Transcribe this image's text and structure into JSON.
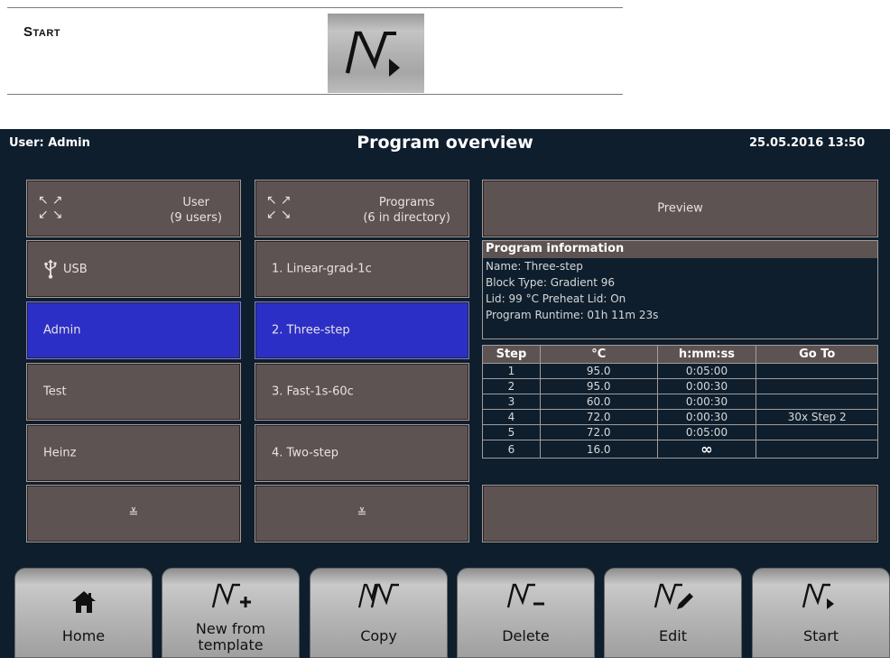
{
  "manual": {
    "label": "Start"
  },
  "status": {
    "user": "User: Admin",
    "title": "Program overview",
    "datetime": "25.05.2016 13:50"
  },
  "user_header": {
    "line1": "User",
    "line2": "(9 users)"
  },
  "programs_header": {
    "line1": "Programs",
    "line2": "(6 in directory)"
  },
  "users": [
    {
      "label": "USB",
      "icon": "usb-icon",
      "selected": false
    },
    {
      "label": "Admin",
      "selected": true
    },
    {
      "label": "Test",
      "selected": false
    },
    {
      "label": "Heinz",
      "selected": false
    }
  ],
  "programs": [
    {
      "label": "1. Linear-grad-1c",
      "selected": false
    },
    {
      "label": "2. Three-step",
      "selected": true
    },
    {
      "label": "3. Fast-1s-60c",
      "selected": false
    },
    {
      "label": "4. Two-step",
      "selected": false
    }
  ],
  "scroll_glyph": "≚",
  "preview_label": "Preview",
  "program_info": {
    "header": "Program information",
    "name": "Name: Three-step",
    "block_type": "Block Type: Gradient 96",
    "lid": "Lid: 99 °C  Preheat Lid: On",
    "runtime": "Program Runtime: 01h 11m 23s"
  },
  "steps_table": {
    "headers": [
      "Step",
      "°C",
      "h:mm:ss",
      "Go To"
    ],
    "rows": [
      [
        "1",
        "95.0",
        "0:05:00",
        ""
      ],
      [
        "2",
        "95.0",
        "0:00:30",
        ""
      ],
      [
        "3",
        "60.0",
        "0:00:30",
        ""
      ],
      [
        "4",
        "72.0",
        "0:00:30",
        "30x Step 2"
      ],
      [
        "5",
        "72.0",
        "0:05:00",
        ""
      ],
      [
        "6",
        "16.0",
        "∞",
        ""
      ]
    ]
  },
  "toolbar": {
    "home": "Home",
    "new_line1": "New from",
    "new_line2": "template",
    "copy": "Copy",
    "delete": "Delete",
    "edit": "Edit",
    "start": "Start"
  },
  "colors": {
    "screen_bg": "#0e1e2d",
    "panel": "#5d5352",
    "selected": "#2b2fc6"
  }
}
